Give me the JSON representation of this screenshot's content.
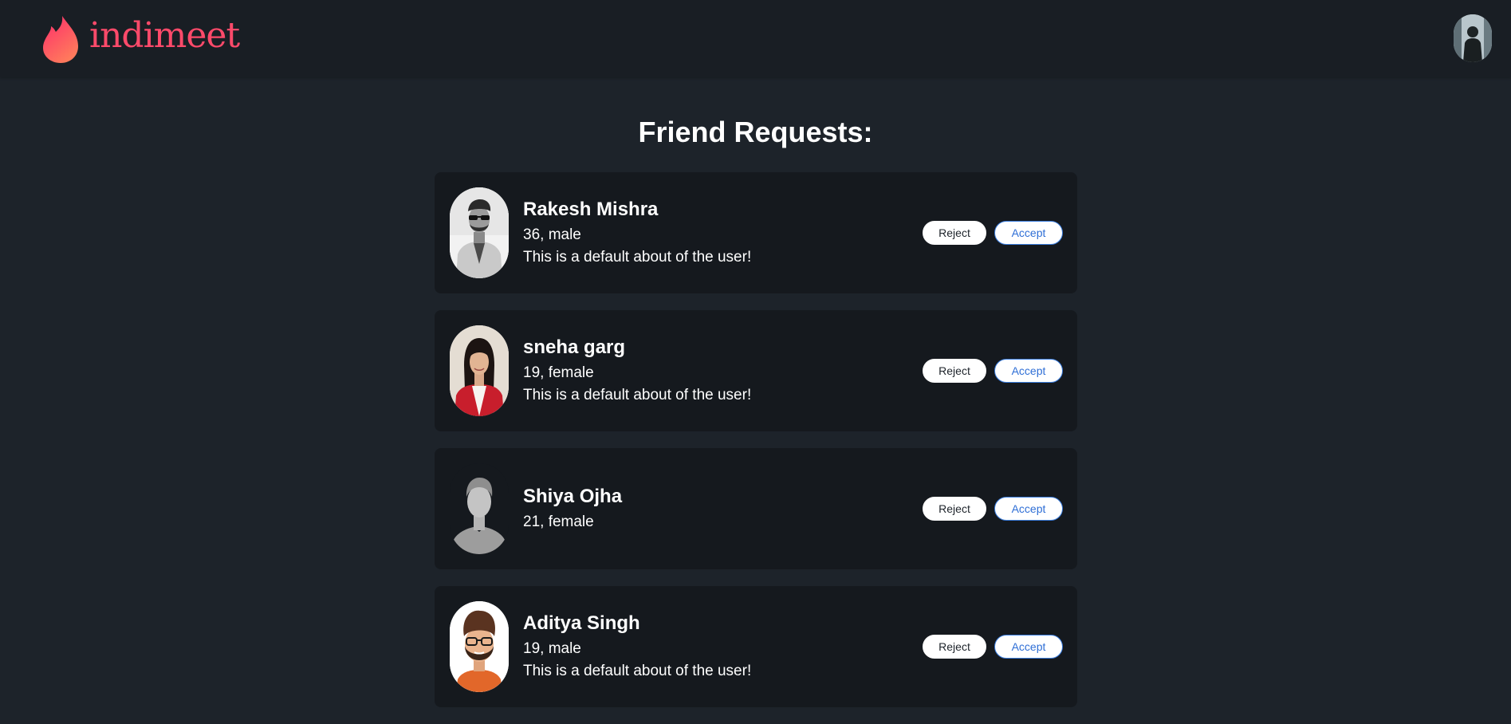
{
  "navbar": {
    "brand": "indimeet",
    "brand_color": "#fd4a6a",
    "profile_icon": "user-avatar"
  },
  "page": {
    "title": "Friend Requests:"
  },
  "requests": [
    {
      "name": "Rakesh Mishra",
      "meta": "36, male",
      "about": "This is a default about of the user!",
      "avatar": "bw-portrait-sunglasses",
      "reject_label": "Reject",
      "accept_label": "Accept"
    },
    {
      "name": "sneha garg",
      "meta": "19, female",
      "about": "This is a default about of the user!",
      "avatar": "portrait-red-blazer",
      "reject_label": "Reject",
      "accept_label": "Accept"
    },
    {
      "name": "Shiya Ojha",
      "meta": "21, female",
      "about": "",
      "avatar": "default-silhouette",
      "reject_label": "Reject",
      "accept_label": "Accept"
    },
    {
      "name": "Aditya Singh",
      "meta": "19, male",
      "about": "This is a default about of the user!",
      "avatar": "cartoon-bearded-man",
      "reject_label": "Reject",
      "accept_label": "Accept"
    }
  ],
  "colors": {
    "background": "#1d232a",
    "navbar": "#191e24",
    "card": "#15191e",
    "accept_text": "#2f6fd6"
  }
}
